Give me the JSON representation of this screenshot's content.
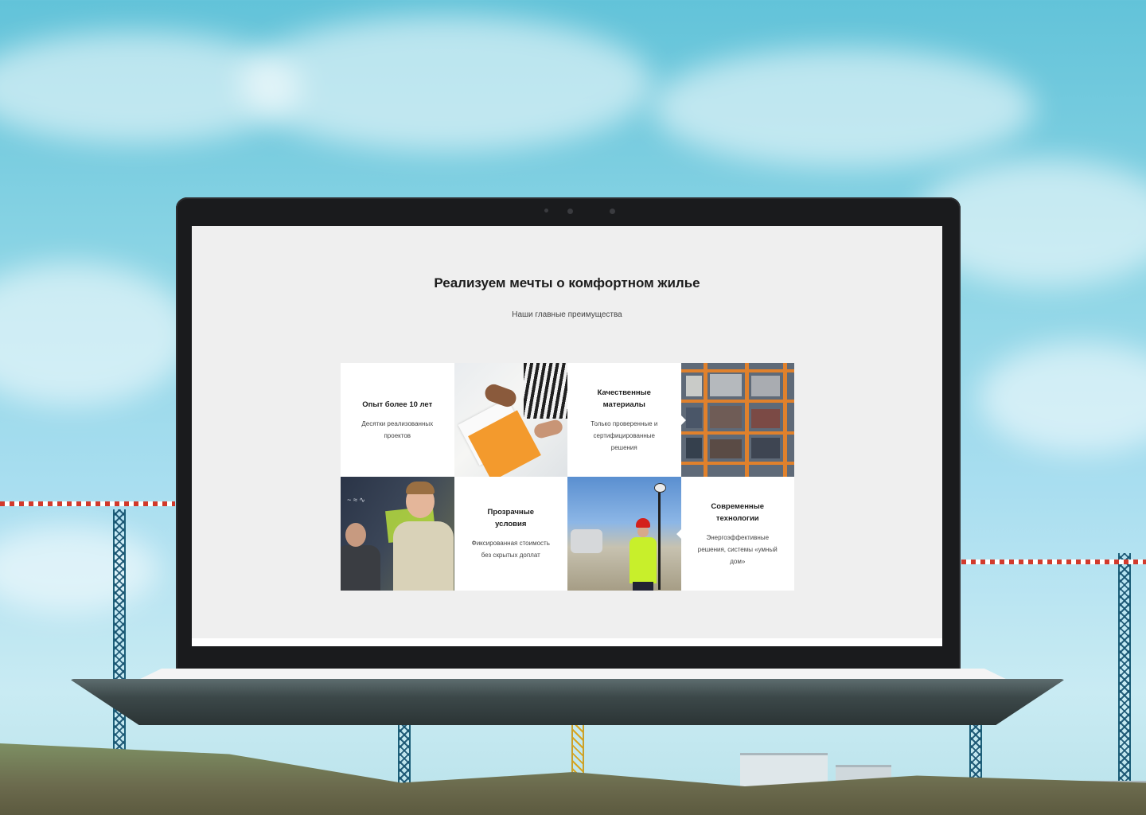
{
  "section": {
    "title": "Реализуем мечты о комфортном жилье",
    "subtitle": "Наши главные преимущества"
  },
  "cards": [
    {
      "title": "Опыт более 10 лет",
      "text": "Десятки реализованных проектов"
    },
    {
      "title": "Качественные материалы",
      "text": "Только проверенные и сертифицированные решения"
    },
    {
      "title": "Прозрачные условия",
      "text": "Фиксированная стоимость без скрытых доплат"
    },
    {
      "title": "Современные технологии",
      "text": "Энергоэффективные решения, системы «умный дом»"
    }
  ],
  "photos": {
    "desk": "photo-architects-drawings",
    "shelf": "photo-building-materials-shelves",
    "boys": "photo-people-at-glass-board",
    "survey": "photo-surveyor-on-site"
  }
}
